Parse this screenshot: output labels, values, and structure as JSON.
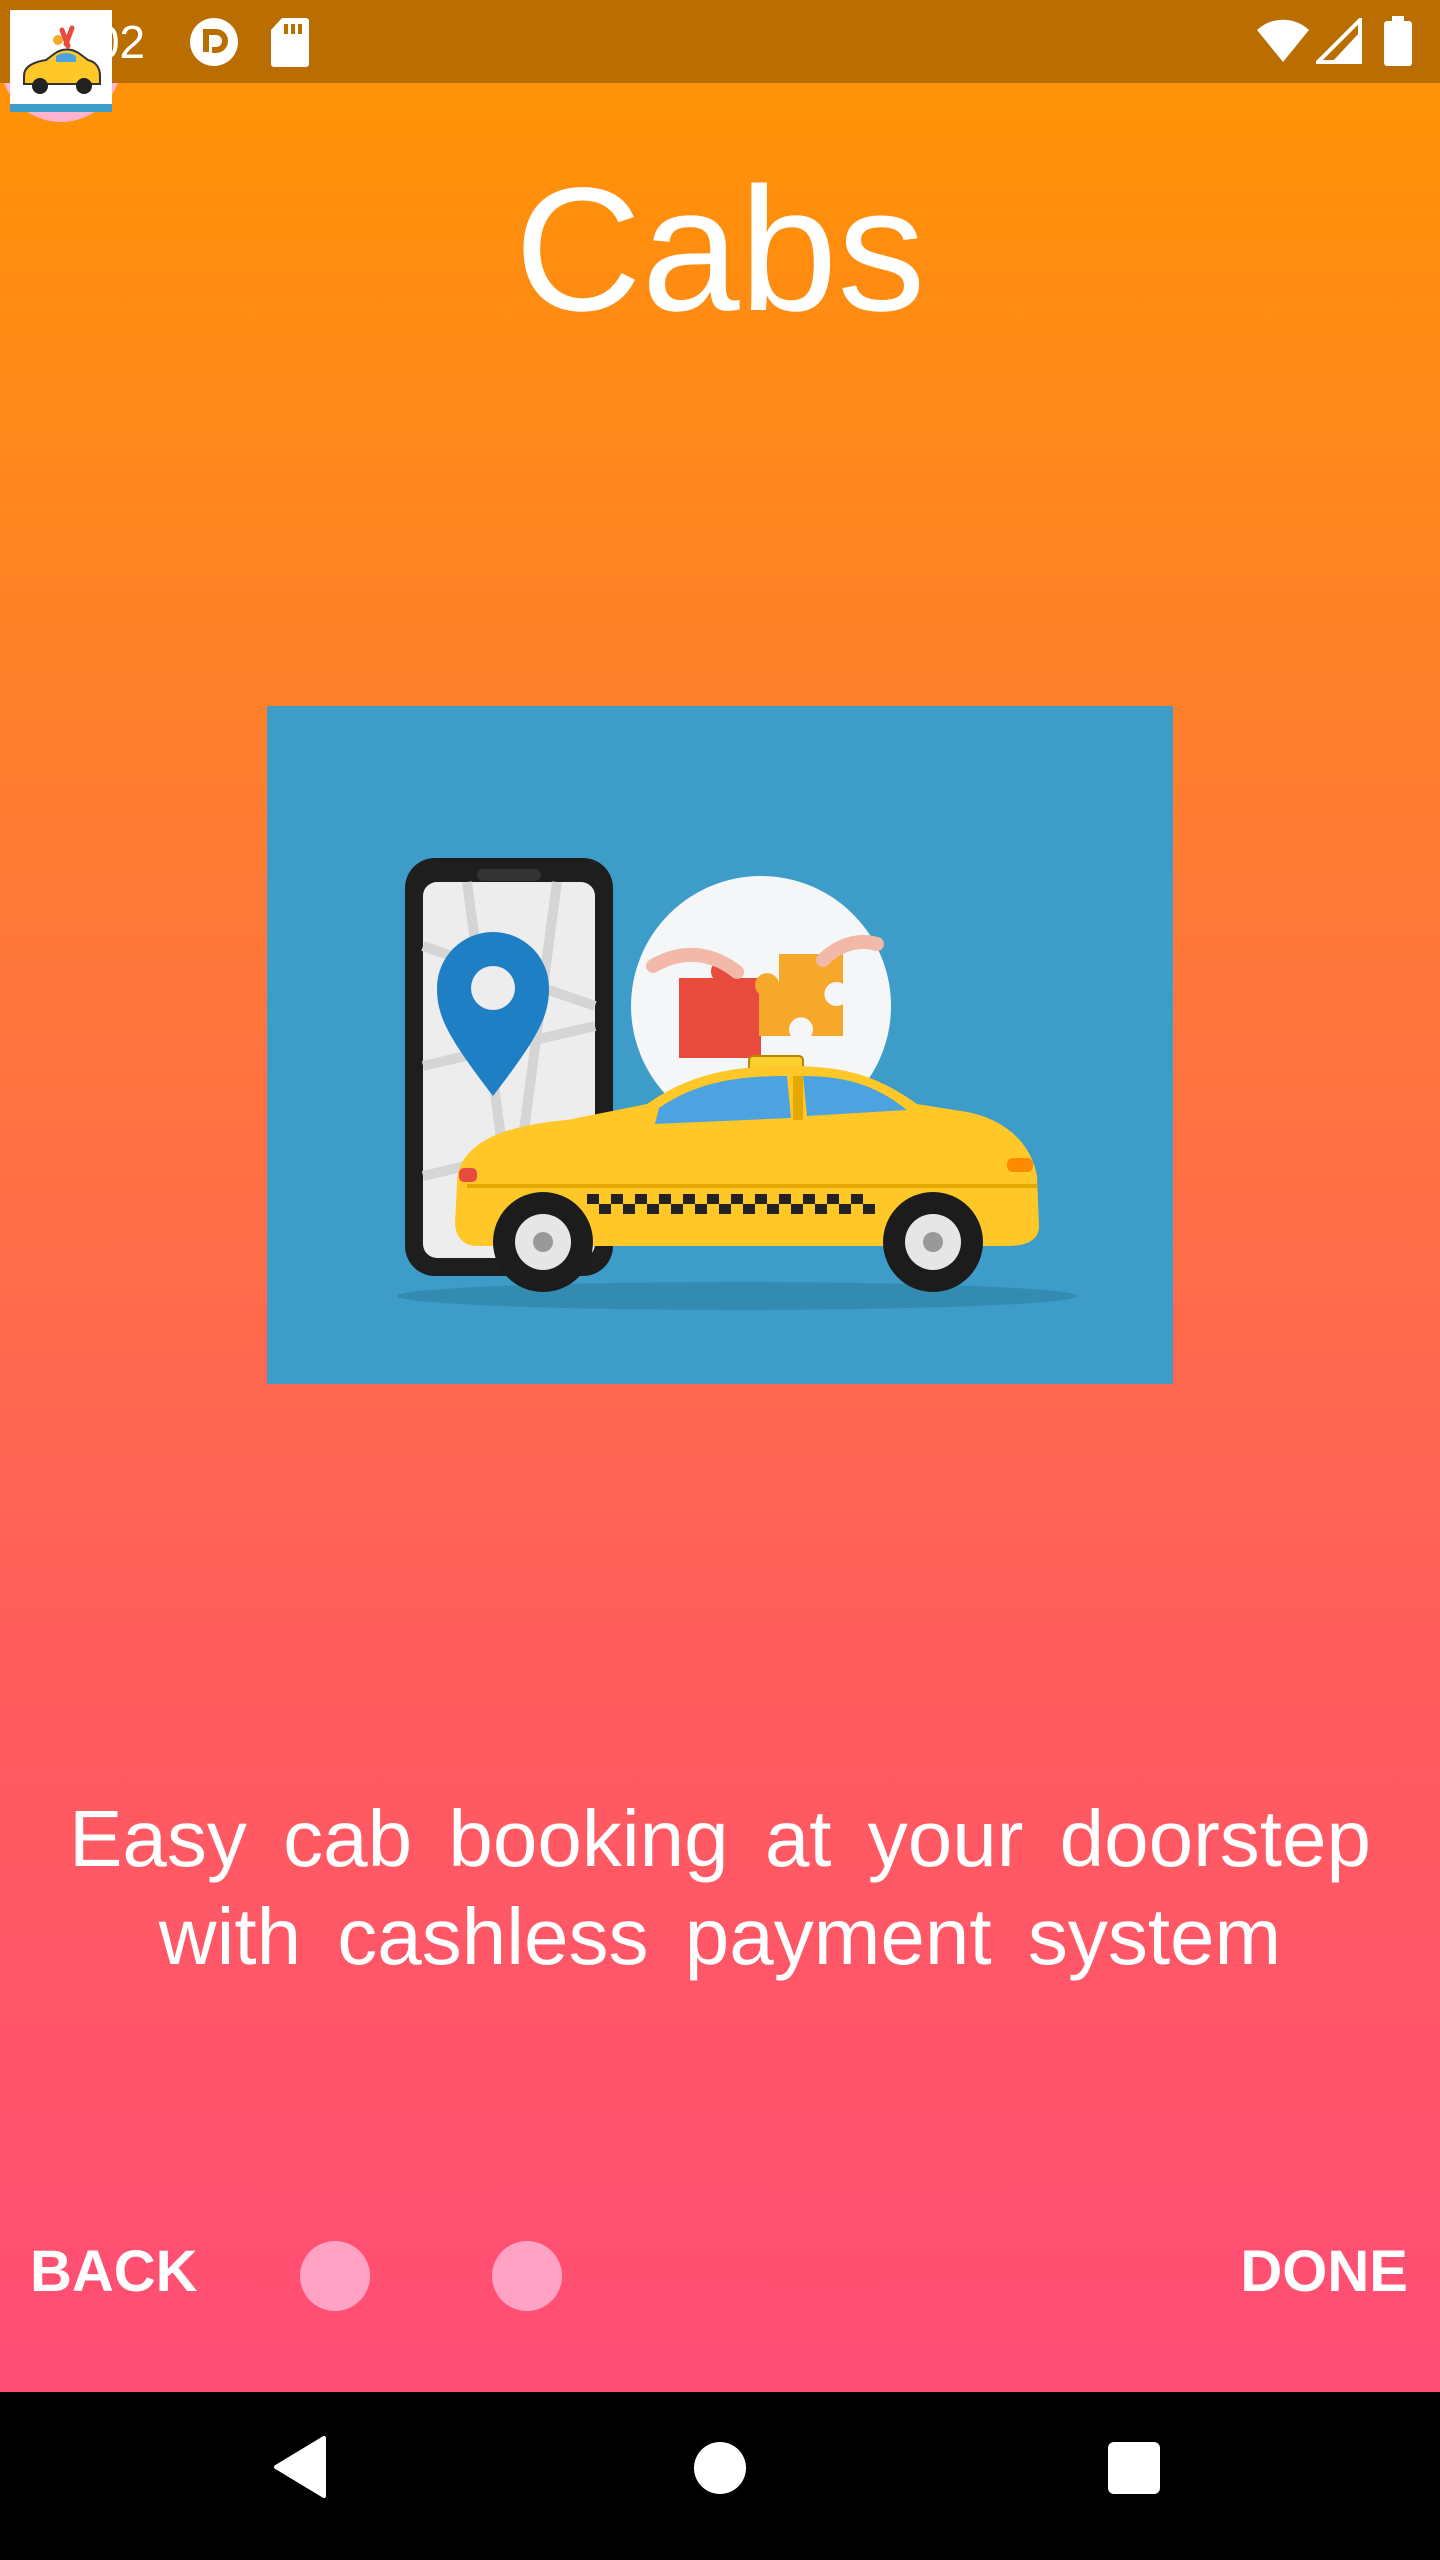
{
  "status_bar": {
    "time": "12:02",
    "left_icons": [
      "pocket-casts-icon",
      "sd-card-icon"
    ],
    "right_icons": [
      "wifi-icon",
      "signal-icon",
      "battery-icon"
    ]
  },
  "slide": {
    "title": "Cabs",
    "illustration": "taxi-booking-illustration",
    "description": "Easy cab booking at your doorstep with cashless payment system"
  },
  "controls": {
    "back_label": "BACK",
    "done_label": "DONE",
    "page_count": 3,
    "current_page": 3
  },
  "colors": {
    "status_bar": "#BA6D00",
    "gradient_top": "#FF9500",
    "gradient_bottom": "#FF4A7C",
    "illustration_bg": "#3E9DC8",
    "taxi_yellow": "#FFC727",
    "inactive_dot": "#FFA2C4"
  },
  "system_nav": {
    "buttons": [
      "back-triangle-icon",
      "home-circle-icon",
      "recents-square-icon"
    ]
  }
}
